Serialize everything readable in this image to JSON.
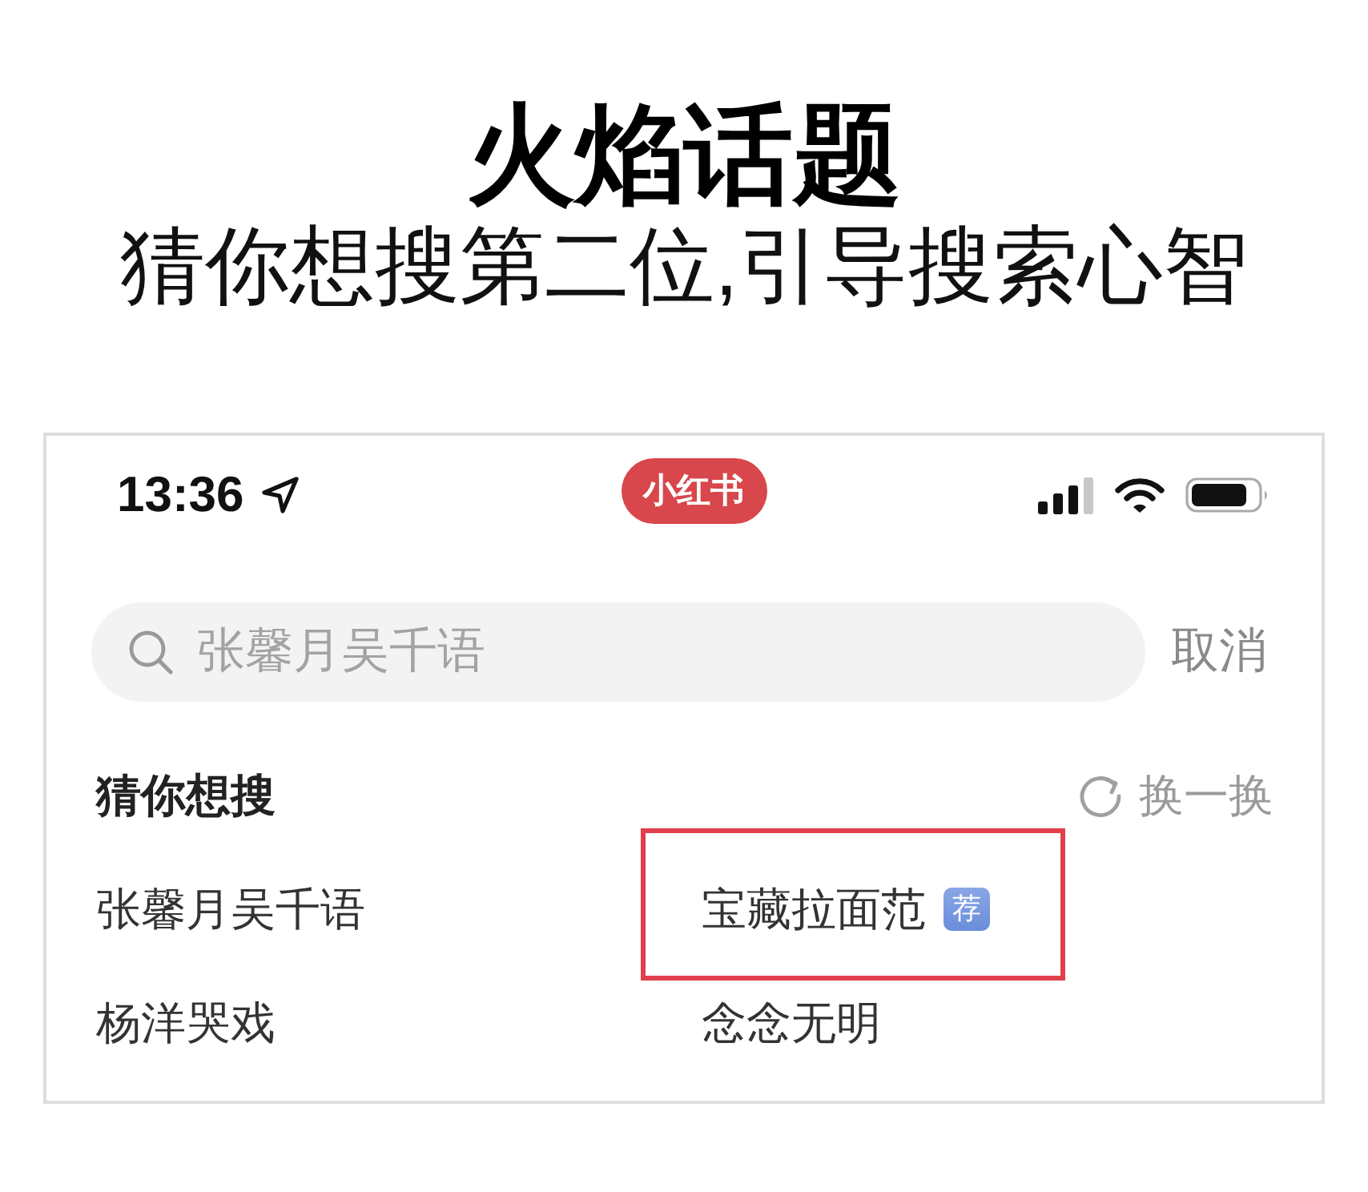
{
  "headline": {
    "title": "火焰话题",
    "subtitle": "猜你想搜第二位,引导搜索心智"
  },
  "status_bar": {
    "time": "13:36"
  },
  "app_logo": {
    "text": "小红书"
  },
  "search": {
    "placeholder": "张馨月吴千语",
    "cancel": "取消"
  },
  "suggestions": {
    "title": "猜你想搜",
    "refresh": "换一换",
    "items": [
      {
        "text": "张馨月吴千语",
        "highlighted": false
      },
      {
        "text": "宝藏拉面范",
        "tag": "荐",
        "highlighted": true
      },
      {
        "text": "杨洋哭戏",
        "highlighted": false
      },
      {
        "text": "念念无明",
        "highlighted": false
      }
    ]
  }
}
